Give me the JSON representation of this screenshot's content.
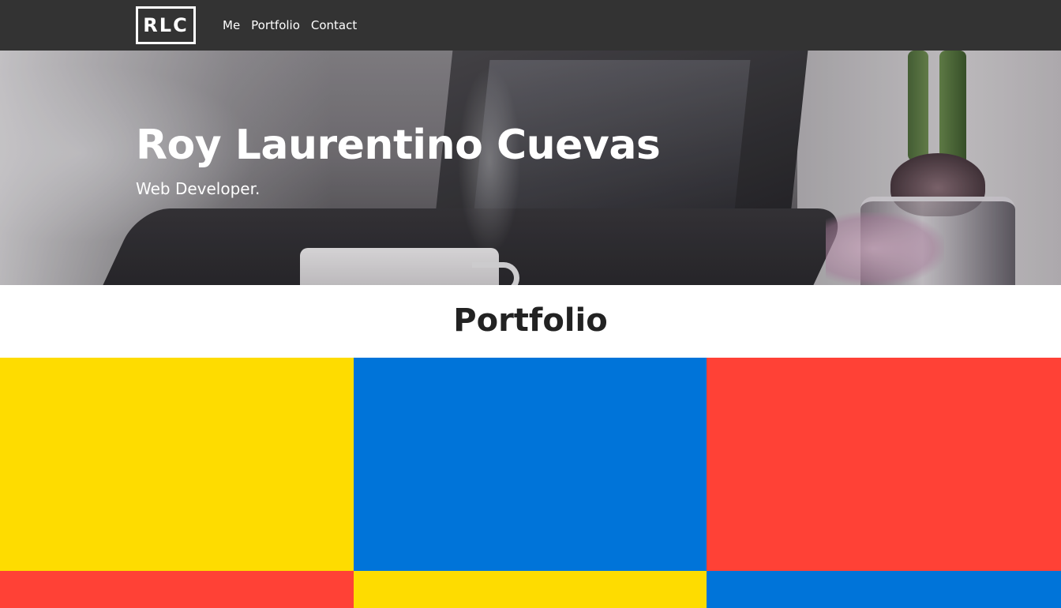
{
  "nav": {
    "logo": "RLC",
    "links": [
      "Me",
      "Portfolio",
      "Contact"
    ]
  },
  "hero": {
    "title": "Roy Laurentino Cuevas",
    "subtitle": "Web Developer."
  },
  "portfolio": {
    "heading": "Portfolio",
    "tile_colors": [
      "#FEDC00",
      "#0074D9",
      "#FF4136",
      "#FF4136",
      "#FEDC00",
      "#0074D9"
    ]
  }
}
